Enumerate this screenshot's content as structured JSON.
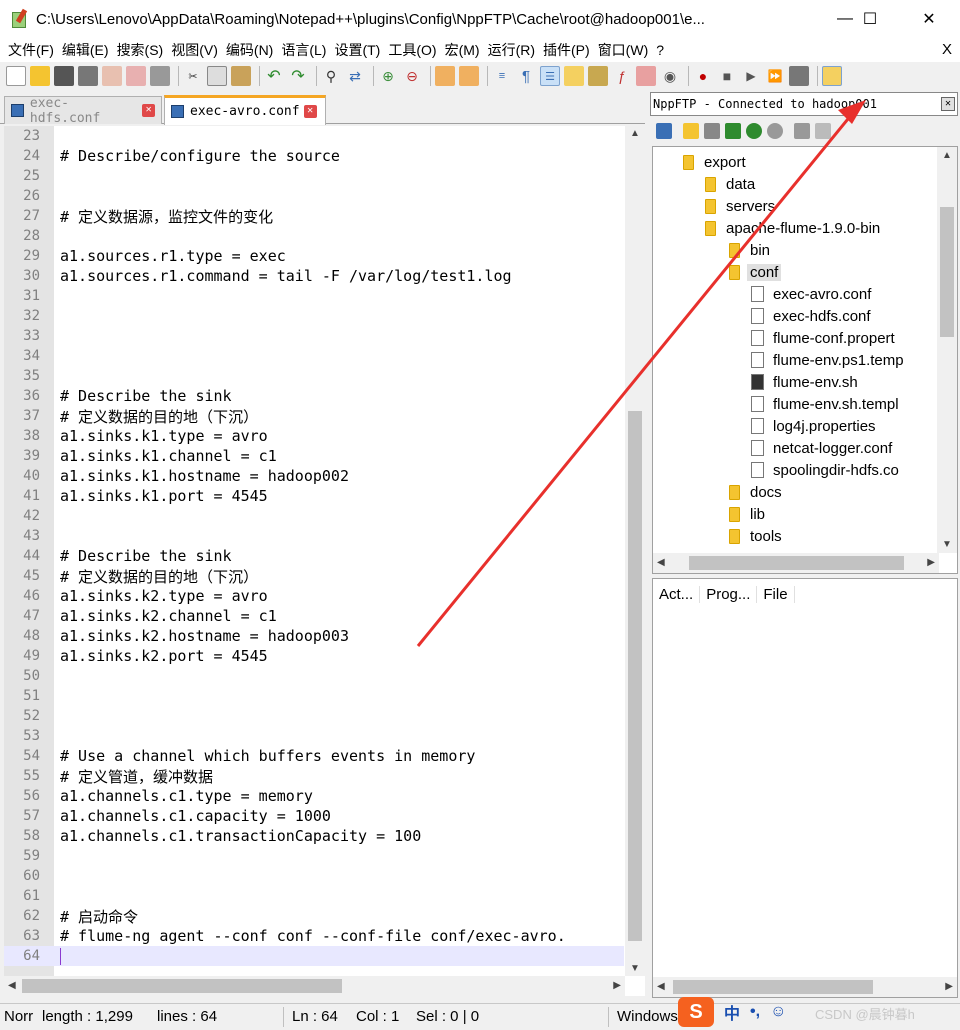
{
  "window": {
    "title": "C:\\Users\\Lenovo\\AppData\\Roaming\\Notepad++\\plugins\\Config\\NppFTP\\Cache\\root@hadoop001\\e...",
    "minimize": "—",
    "maximize": "☐",
    "close": "✕"
  },
  "menu": {
    "items": [
      "文件(F)",
      "编辑(E)",
      "搜索(S)",
      "视图(V)",
      "编码(N)",
      "语言(L)",
      "设置(T)",
      "工具(O)",
      "宏(M)",
      "运行(R)",
      "插件(P)",
      "窗口(W)",
      "?"
    ],
    "close": "X"
  },
  "tabs": [
    {
      "label": "exec-hdfs.conf",
      "active": false
    },
    {
      "label": "exec-avro.conf",
      "active": true
    }
  ],
  "editor": {
    "lines": [
      {
        "n": "23",
        "text": ""
      },
      {
        "n": "24",
        "text": "# Describe/configure the source"
      },
      {
        "n": "25",
        "text": ""
      },
      {
        "n": "26",
        "text": ""
      },
      {
        "n": "27",
        "text": "# 定义数据源，监控文件的变化"
      },
      {
        "n": "28",
        "text": ""
      },
      {
        "n": "29",
        "text": "a1.sources.r1.type = exec"
      },
      {
        "n": "30",
        "text": "a1.sources.r1.command = tail -F /var/log/test1.log"
      },
      {
        "n": "31",
        "text": ""
      },
      {
        "n": "32",
        "text": ""
      },
      {
        "n": "33",
        "text": ""
      },
      {
        "n": "34",
        "text": ""
      },
      {
        "n": "35",
        "text": ""
      },
      {
        "n": "36",
        "text": "# Describe the sink"
      },
      {
        "n": "37",
        "text": "# 定义数据的目的地（下沉）"
      },
      {
        "n": "38",
        "text": "a1.sinks.k1.type = avro"
      },
      {
        "n": "39",
        "text": "a1.sinks.k1.channel = c1"
      },
      {
        "n": "40",
        "text": "a1.sinks.k1.hostname = hadoop002"
      },
      {
        "n": "41",
        "text": "a1.sinks.k1.port = 4545"
      },
      {
        "n": "42",
        "text": ""
      },
      {
        "n": "43",
        "text": ""
      },
      {
        "n": "44",
        "text": "# Describe the sink"
      },
      {
        "n": "45",
        "text": "# 定义数据的目的地（下沉）"
      },
      {
        "n": "46",
        "text": "a1.sinks.k2.type = avro"
      },
      {
        "n": "47",
        "text": "a1.sinks.k2.channel = c1"
      },
      {
        "n": "48",
        "text": "a1.sinks.k2.hostname = hadoop003"
      },
      {
        "n": "49",
        "text": "a1.sinks.k2.port = 4545"
      },
      {
        "n": "50",
        "text": ""
      },
      {
        "n": "51",
        "text": ""
      },
      {
        "n": "52",
        "text": ""
      },
      {
        "n": "53",
        "text": ""
      },
      {
        "n": "54",
        "text": "# Use a channel which buffers events in memory"
      },
      {
        "n": "55",
        "text": "# 定义管道，缓冲数据"
      },
      {
        "n": "56",
        "text": "a1.channels.c1.type = memory"
      },
      {
        "n": "57",
        "text": "a1.channels.c1.capacity = 1000"
      },
      {
        "n": "58",
        "text": "a1.channels.c1.transactionCapacity = 100"
      },
      {
        "n": "59",
        "text": ""
      },
      {
        "n": "60",
        "text": ""
      },
      {
        "n": "61",
        "text": ""
      },
      {
        "n": "62",
        "text": "# 启动命令"
      },
      {
        "n": "63",
        "text": "# flume-ng agent --conf conf --conf-file conf/exec-avro."
      },
      {
        "n": "64",
        "text": ""
      }
    ],
    "current_line": "64"
  },
  "ftp": {
    "status": "NppFTP - Connected to hadoop001",
    "close": "✕",
    "tree": [
      {
        "label": "export",
        "kind": "folder",
        "depth": 0
      },
      {
        "label": "data",
        "kind": "folder",
        "depth": 1
      },
      {
        "label": "servers",
        "kind": "folder",
        "depth": 1
      },
      {
        "label": "apache-flume-1.9.0-bin",
        "kind": "folder",
        "depth": 2
      },
      {
        "label": "bin",
        "kind": "folder",
        "depth": 3
      },
      {
        "label": "conf",
        "kind": "folder",
        "depth": 3,
        "selected": true
      },
      {
        "label": "exec-avro.conf",
        "kind": "file",
        "depth": 4
      },
      {
        "label": "exec-hdfs.conf",
        "kind": "file",
        "depth": 4
      },
      {
        "label": "flume-conf.propert",
        "kind": "file",
        "depth": 4
      },
      {
        "label": "flume-env.ps1.temp",
        "kind": "file",
        "depth": 4
      },
      {
        "label": "flume-env.sh",
        "kind": "sh",
        "depth": 4
      },
      {
        "label": "flume-env.sh.templ",
        "kind": "file",
        "depth": 4
      },
      {
        "label": "log4j.properties",
        "kind": "file",
        "depth": 4
      },
      {
        "label": "netcat-logger.conf",
        "kind": "file",
        "depth": 4
      },
      {
        "label": "spoolingdir-hdfs.co",
        "kind": "file",
        "depth": 4
      },
      {
        "label": "docs",
        "kind": "folder",
        "depth": 3
      },
      {
        "label": "lib",
        "kind": "folder",
        "depth": 3
      },
      {
        "label": "tools",
        "kind": "folder",
        "depth": 3
      }
    ],
    "queue_columns": [
      "Act...",
      "Prog...",
      "File"
    ]
  },
  "status": {
    "type": "Norr",
    "length": "length : 1,299",
    "lines": "lines : 64",
    "ln": "Ln : 64",
    "col": "Col : 1",
    "sel": "Sel : 0 | 0",
    "eol": "Windows"
  },
  "ime": {
    "logo": "S",
    "lang": "中",
    "punct": "•,",
    "emoji": "☺"
  },
  "watermark": "CSDN @晨钟暮h",
  "colors": {
    "accent_tab": "#f5a623",
    "annotation_arrow": "#e8302c",
    "current_line": "#e8e8ff"
  }
}
